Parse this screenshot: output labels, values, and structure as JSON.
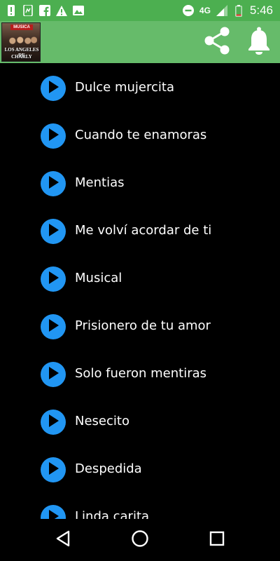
{
  "status_bar": {
    "time": "5:46",
    "network": "4G",
    "icons_left": [
      "alert-icon",
      "sim-phone-icon",
      "facebook-icon",
      "warning-icon",
      "image-icon"
    ],
    "icons_right": [
      "do-not-disturb-icon",
      "signal-icon",
      "battery-icon"
    ]
  },
  "app_bar": {
    "logo": {
      "top_text": "MUSICA",
      "line1": "LOS ANGELES DE",
      "line2": "CHARLY"
    },
    "actions": [
      "share-icon",
      "bell-icon"
    ],
    "color": "#66bb6a"
  },
  "songs": [
    {
      "title": "Dulce mujercita"
    },
    {
      "title": "Cuando te enamoras"
    },
    {
      "title": "Mentias"
    },
    {
      "title": "Me volví acordar de ti"
    },
    {
      "title": "Musical"
    },
    {
      "title": "Prisionero de tu amor"
    },
    {
      "title": "Solo fueron mentiras"
    },
    {
      "title": "Nesecito"
    },
    {
      "title": "Despedida"
    },
    {
      "title": "Linda carita"
    }
  ],
  "colors": {
    "status_bar": "#4caf50",
    "play_button": "#2196f3",
    "background": "#000000"
  },
  "nav_bar": [
    "back-icon",
    "home-icon",
    "recents-icon"
  ]
}
